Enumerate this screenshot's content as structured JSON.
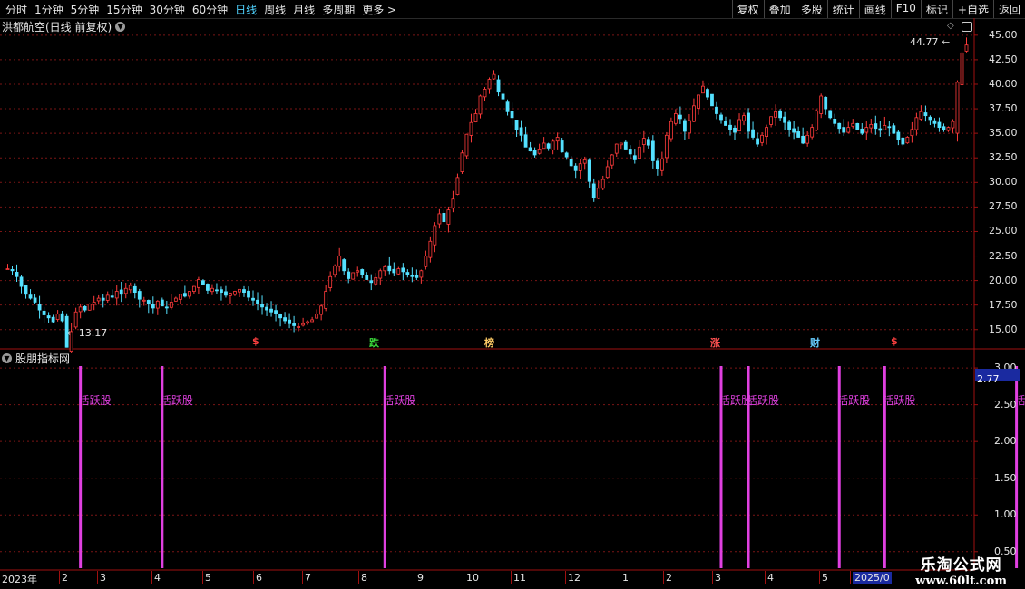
{
  "toolbar": {
    "tabs": [
      "分时",
      "1分钟",
      "5分钟",
      "15分钟",
      "30分钟",
      "60分钟",
      "日线",
      "周线",
      "月线",
      "多周期",
      "更多 >"
    ],
    "active_tab": "日线",
    "tools": [
      "复权",
      "叠加",
      "多股",
      "统计",
      "画线",
      "F10",
      "+自选",
      "返回",
      "标记"
    ]
  },
  "chart_title": "洪都航空(日线 前复权)",
  "indicator_title": "股朋指标网",
  "price_axis": [
    "45.00",
    "42.50",
    "40.00",
    "37.50",
    "35.00",
    "32.50",
    "30.00",
    "27.50",
    "25.00",
    "22.50",
    "20.00",
    "17.50",
    "15.00"
  ],
  "indicator_axis": [
    "3.00",
    "2.50",
    "2.00",
    "1.50",
    "1.00",
    "0.50"
  ],
  "indicator_current": "2.77",
  "high_label": "44.77",
  "low_label": "13.17",
  "events": [
    {
      "text": "$",
      "color": "#ff4040"
    },
    {
      "text": "跌",
      "color": "#3bdc3b"
    },
    {
      "text": "榜",
      "color": "#ffcc66"
    },
    {
      "text": "涨",
      "color": "#ff5050"
    },
    {
      "text": "财",
      "color": "#66ccff"
    },
    {
      "text": "$",
      "color": "#ff4040"
    }
  ],
  "indicator_signal_label": "活跃股",
  "date_axis": [
    "2023年",
    "2",
    "3",
    "4",
    "5",
    "6",
    "7",
    "8",
    "9",
    "10",
    "11",
    "12",
    "1",
    "2",
    "3",
    "4",
    "5",
    "2025/0"
  ],
  "watermark": {
    "title": "乐淘公式网",
    "url": "www.60lt.com"
  },
  "colors": {
    "up": "#ff3b3b",
    "down": "#54e1ff",
    "grid": "#7a1515",
    "signal": "#e040e0"
  },
  "chart_data": {
    "type": "candlestick",
    "title": "洪都航空(日线 前复权)",
    "ylim": [
      13.5,
      46
    ],
    "close_series": [
      21.2,
      21.0,
      20.4,
      19.4,
      18.6,
      18.2,
      17.8,
      17.0,
      16.5,
      16.2,
      15.8,
      16.6,
      15.9,
      13.2,
      14.8,
      16.8,
      17.3,
      17.0,
      17.6,
      17.8,
      18.2,
      18.0,
      18.5,
      18.3,
      18.9,
      18.6,
      19.2,
      19.5,
      18.8,
      18.1,
      18.0,
      17.6,
      17.2,
      17.9,
      17.4,
      17.2,
      17.8,
      18.2,
      18.6,
      18.4,
      18.9,
      19.4,
      20.1,
      19.6,
      19.0,
      19.2,
      19.0,
      18.8,
      18.5,
      18.7,
      18.9,
      19.1,
      18.8,
      18.3,
      18.0,
      17.6,
      17.3,
      17.0,
      16.8,
      16.6,
      16.2,
      15.9,
      15.6,
      15.4,
      15.3,
      15.6,
      15.8,
      16.0,
      16.6,
      17.4,
      18.9,
      20.4,
      21.5,
      22.5,
      21.0,
      20.2,
      20.8,
      21.0,
      20.6,
      20.1,
      19.8,
      20.3,
      21.0,
      21.4,
      21.0,
      20.8,
      21.2,
      20.9,
      20.6,
      20.4,
      20.3,
      21.0,
      22.5,
      24.0,
      25.6,
      26.8,
      26.0,
      27.2,
      28.3,
      30.5,
      33.0,
      34.9,
      36.1,
      37.0,
      38.8,
      39.5,
      40.5,
      41.0,
      39.2,
      38.5,
      37.2,
      36.6,
      35.4,
      34.8,
      33.6,
      33.2,
      32.8,
      33.4,
      34.0,
      33.5,
      34.2,
      34.6,
      33.1,
      32.6,
      31.7,
      31.2,
      31.9,
      32.3,
      30.1,
      28.4,
      29.4,
      30.3,
      31.6,
      32.8,
      33.9,
      34.0,
      33.4,
      32.9,
      32.3,
      33.6,
      34.5,
      33.8,
      32.2,
      31.4,
      32.4,
      34.8,
      36.2,
      37.0,
      36.5,
      35.2,
      36.3,
      37.8,
      38.9,
      39.8,
      38.7,
      37.8,
      37.0,
      36.4,
      35.8,
      35.4,
      35.1,
      36.4,
      36.8,
      35.2,
      34.6,
      33.9,
      34.8,
      35.6,
      36.7,
      37.2,
      36.6,
      36.1,
      35.4,
      35.1,
      34.6,
      34.0,
      34.8,
      35.6,
      37.3,
      38.8,
      37.5,
      36.6,
      36.0,
      35.5,
      35.1,
      35.6,
      36.0,
      35.4,
      35.0,
      35.6,
      35.9,
      35.5,
      35.3,
      35.8,
      35.6,
      35.0,
      34.4,
      33.9,
      34.6,
      35.4,
      36.6,
      37.2,
      36.8,
      36.4,
      36.0,
      35.6,
      35.4,
      35.6,
      36.2,
      40.2,
      43.2,
      44.0
    ],
    "high": 44.77,
    "low": 13.17,
    "indicator": {
      "name": "活跃股",
      "ylim": [
        0.3,
        3.1
      ],
      "signal_indices": [
        16,
        34,
        83,
        157,
        163,
        183,
        193,
        222
      ]
    },
    "x_labels": [
      "2023年",
      "2",
      "3",
      "4",
      "5",
      "6",
      "7",
      "8",
      "9",
      "10",
      "11",
      "12",
      "1",
      "2",
      "3",
      "4",
      "5",
      "2025/0"
    ]
  }
}
